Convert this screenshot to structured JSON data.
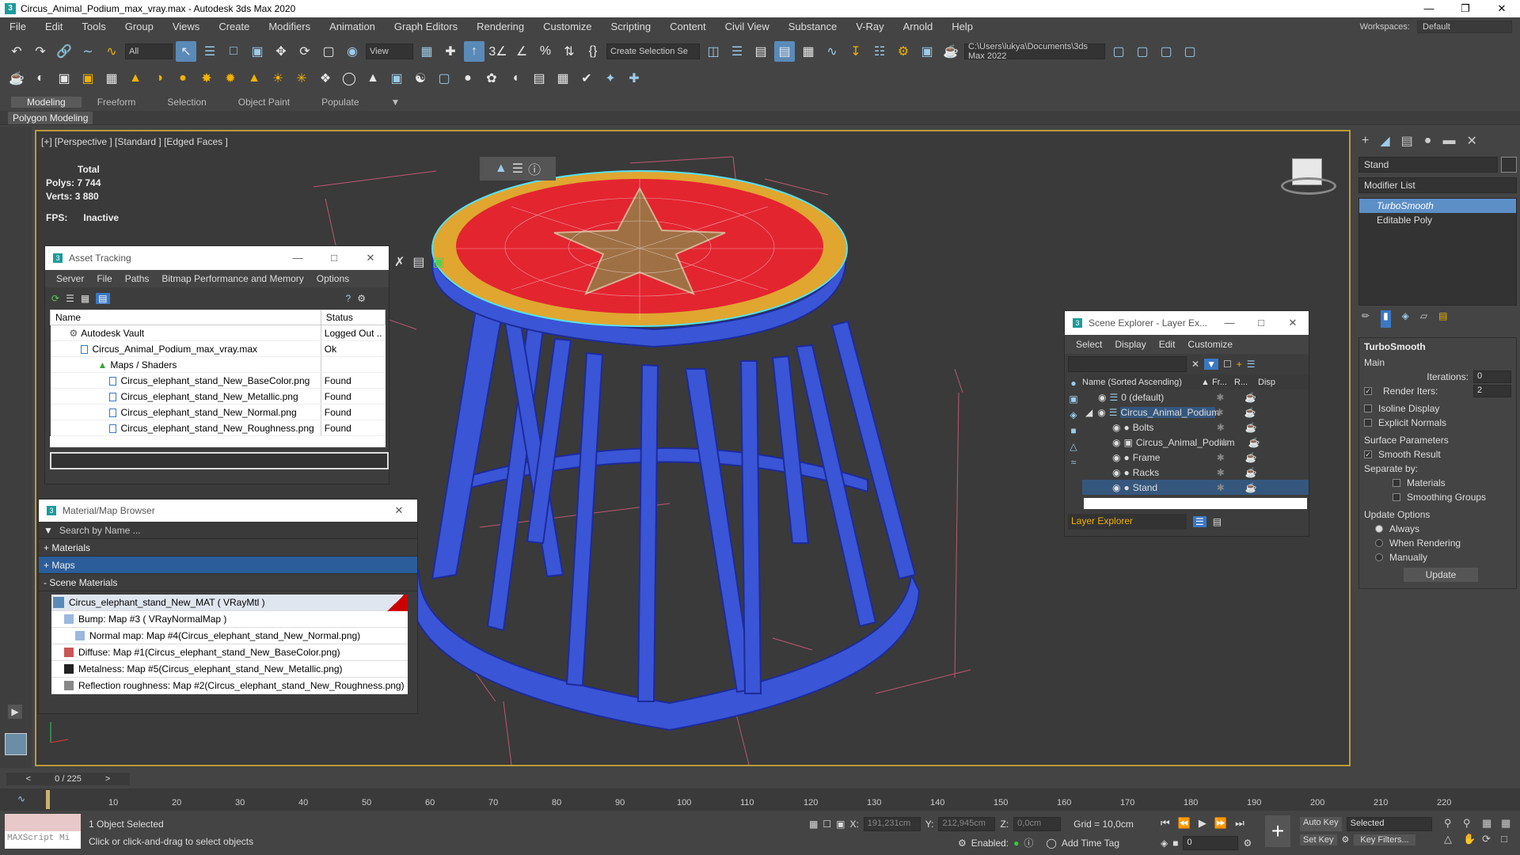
{
  "titlebar": {
    "title": "Circus_Animal_Podium_max_vray.max - Autodesk 3ds Max 2020"
  },
  "menu": [
    "File",
    "Edit",
    "Tools",
    "Group",
    "Views",
    "Create",
    "Modifiers",
    "Animation",
    "Graph Editors",
    "Rendering",
    "Customize",
    "Scripting",
    "Content",
    "Civil View",
    "Substance",
    "V-Ray",
    "Arnold",
    "Help"
  ],
  "workspace": {
    "label": "Workspaces:",
    "value": "Default"
  },
  "toolbar": {
    "filter_value": "All",
    "refcoord_value": "View",
    "selection_set_placeholder": "Create Selection Se",
    "path_value": "C:\\Users\\lukya\\Documents\\3ds Max 2022"
  },
  "ribbon": {
    "tabs": [
      "Modeling",
      "Freeform",
      "Selection",
      "Object Paint",
      "Populate"
    ],
    "active": "Modeling",
    "sub_label": "Polygon Modeling"
  },
  "viewport": {
    "label": "[+] [Perspective ] [Standard ] [Edged Faces ]",
    "stats": {
      "header": "Total",
      "polys_label": "Polys:",
      "polys": "7 744",
      "verts_label": "Verts:",
      "verts": "3 880",
      "fps_label": "FPS:",
      "fps": "Inactive"
    }
  },
  "asset_tracking": {
    "title": "Asset Tracking",
    "menu": [
      "Server",
      "File",
      "Paths",
      "Bitmap Performance and Memory",
      "Options"
    ],
    "columns": [
      "Name",
      "Status"
    ],
    "rows": [
      {
        "name": "Autodesk Vault",
        "status": "Logged Out .."
      },
      {
        "name": "Circus_Animal_Podium_max_vray.max",
        "status": "Ok"
      },
      {
        "name": "Maps / Shaders",
        "status": ""
      },
      {
        "name": "Circus_elephant_stand_New_BaseColor.png",
        "status": "Found"
      },
      {
        "name": "Circus_elephant_stand_New_Metallic.png",
        "status": "Found"
      },
      {
        "name": "Circus_elephant_stand_New_Normal.png",
        "status": "Found"
      },
      {
        "name": "Circus_elephant_stand_New_Roughness.png",
        "status": "Found"
      }
    ]
  },
  "material_browser": {
    "title": "Material/Map Browser",
    "search_placeholder": "Search by Name ...",
    "groups": [
      "+ Materials",
      "+ Maps",
      "- Scene Materials"
    ],
    "items": [
      "Circus_elephant_stand_New_MAT  ( VRayMtl )",
      "Bump: Map #3  ( VRayNormalMap )",
      "Normal map: Map #4(Circus_elephant_stand_New_Normal.png)",
      "Diffuse: Map #1(Circus_elephant_stand_New_BaseColor.png)",
      "Metalness: Map #5(Circus_elephant_stand_New_Metallic.png)",
      "Reflection roughness: Map #2(Circus_elephant_stand_New_Roughness.png)"
    ]
  },
  "scene_explorer": {
    "title": "Scene Explorer - Layer Ex...",
    "menu": [
      "Select",
      "Display",
      "Edit",
      "Customize"
    ],
    "col_name": "Name (Sorted Ascending)",
    "col_fr": "▲ Fr...",
    "col_r": "R...",
    "col_disp": "Disp",
    "rows": [
      {
        "name": "0 (default)",
        "indent": 1
      },
      {
        "name": "Circus_Animal_Podium",
        "indent": 1
      },
      {
        "name": "Bolts",
        "indent": 2
      },
      {
        "name": "Circus_Animal_Podium",
        "indent": 2
      },
      {
        "name": "Frame",
        "indent": 2
      },
      {
        "name": "Racks",
        "indent": 2
      },
      {
        "name": "Stand",
        "indent": 2
      }
    ],
    "footer": "Layer Explorer"
  },
  "command_panel": {
    "object_name": "Stand",
    "modifier_list": "Modifier List",
    "stack": [
      "TurboSmooth",
      "Editable Poly"
    ],
    "rollout": "TurboSmooth",
    "main_label": "Main",
    "iterations_label": "Iterations:",
    "iterations": "0",
    "render_iters_label": "Render Iters:",
    "render_iters": "2",
    "isoline": "Isoline Display",
    "explicit": "Explicit Normals",
    "surface_label": "Surface Parameters",
    "smooth_result": "Smooth Result",
    "separate_by": "Separate by:",
    "materials": "Materials",
    "smoothing_groups": "Smoothing Groups",
    "update_options": "Update Options",
    "always": "Always",
    "when_rendering": "When Rendering",
    "manually": "Manually",
    "update_btn": "Update"
  },
  "timeline": {
    "frame": "0 / 225",
    "ticks": [
      "10",
      "20",
      "30",
      "40",
      "50",
      "60",
      "70",
      "80",
      "90",
      "100",
      "110",
      "120",
      "130",
      "140",
      "150",
      "160",
      "170",
      "180",
      "190",
      "200",
      "210",
      "220"
    ]
  },
  "status": {
    "maxscript": "MAXScript Mi",
    "selected": "1 Object Selected",
    "prompt": "Click or click-and-drag to select objects",
    "x_label": "X:",
    "x": "191,231cm",
    "y_label": "Y:",
    "y": "212,945cm",
    "z_label": "Z:",
    "z": "0,0cm",
    "grid": "Grid = 10,0cm",
    "enabled": "Enabled:",
    "add_time_tag": "Add Time Tag",
    "auto_key": "Auto Key",
    "selected_dd": "Selected",
    "set_key": "Set Key",
    "key_filters": "Key Filters...",
    "frame_field": "0"
  }
}
